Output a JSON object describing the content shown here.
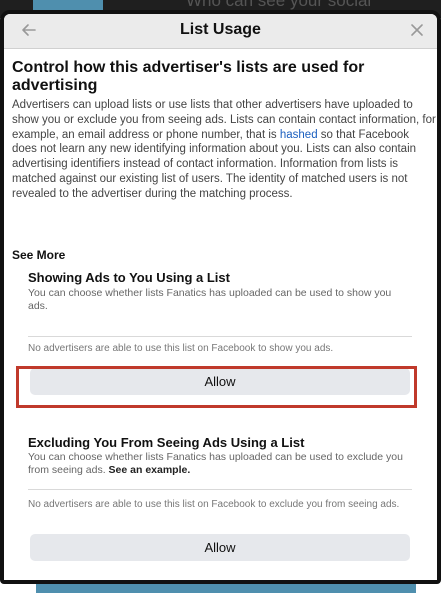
{
  "background": {
    "partial_text": "Who can see your social"
  },
  "dialog": {
    "title": "List Usage",
    "heading": "Control how this advertiser's lists are used for advertising",
    "description_before_link": "Advertisers can upload lists or use lists that other advertisers have uploaded to show you or exclude you from seeing ads. Lists can contain contact information, for example, an email address or phone number, that is ",
    "description_link": "hashed",
    "description_after_link": " so that Facebook does not learn any new identifying information about you. Lists can also contain advertising identifiers instead of contact information. Information from lists is matched against our existing list of users. The identity of matched users is not revealed to the advertiser during the matching process.",
    "see_more": "See More"
  },
  "showing_ads": {
    "title": "Showing Ads to You Using a List",
    "subtitle": "You can choose whether lists Fanatics has uploaded can be used to show you ads.",
    "note": "No advertisers are able to use this list on Facebook to show you ads.",
    "button_label": "Allow"
  },
  "excluding_ads": {
    "title": "Excluding You From Seeing Ads Using a List",
    "subtitle": "You can choose whether lists Fanatics has uploaded can be used to exclude you from seeing ads.",
    "subtitle_link": "See an example.",
    "note": "No advertisers are able to use this list on Facebook to exclude you from seeing ads.",
    "button_label": "Allow"
  },
  "colors": {
    "highlight": "#c0392b",
    "link": "#1b5fbf",
    "accent_background": "#4f8fae"
  },
  "icons": {
    "back": "back-arrow-icon",
    "close": "close-icon"
  }
}
